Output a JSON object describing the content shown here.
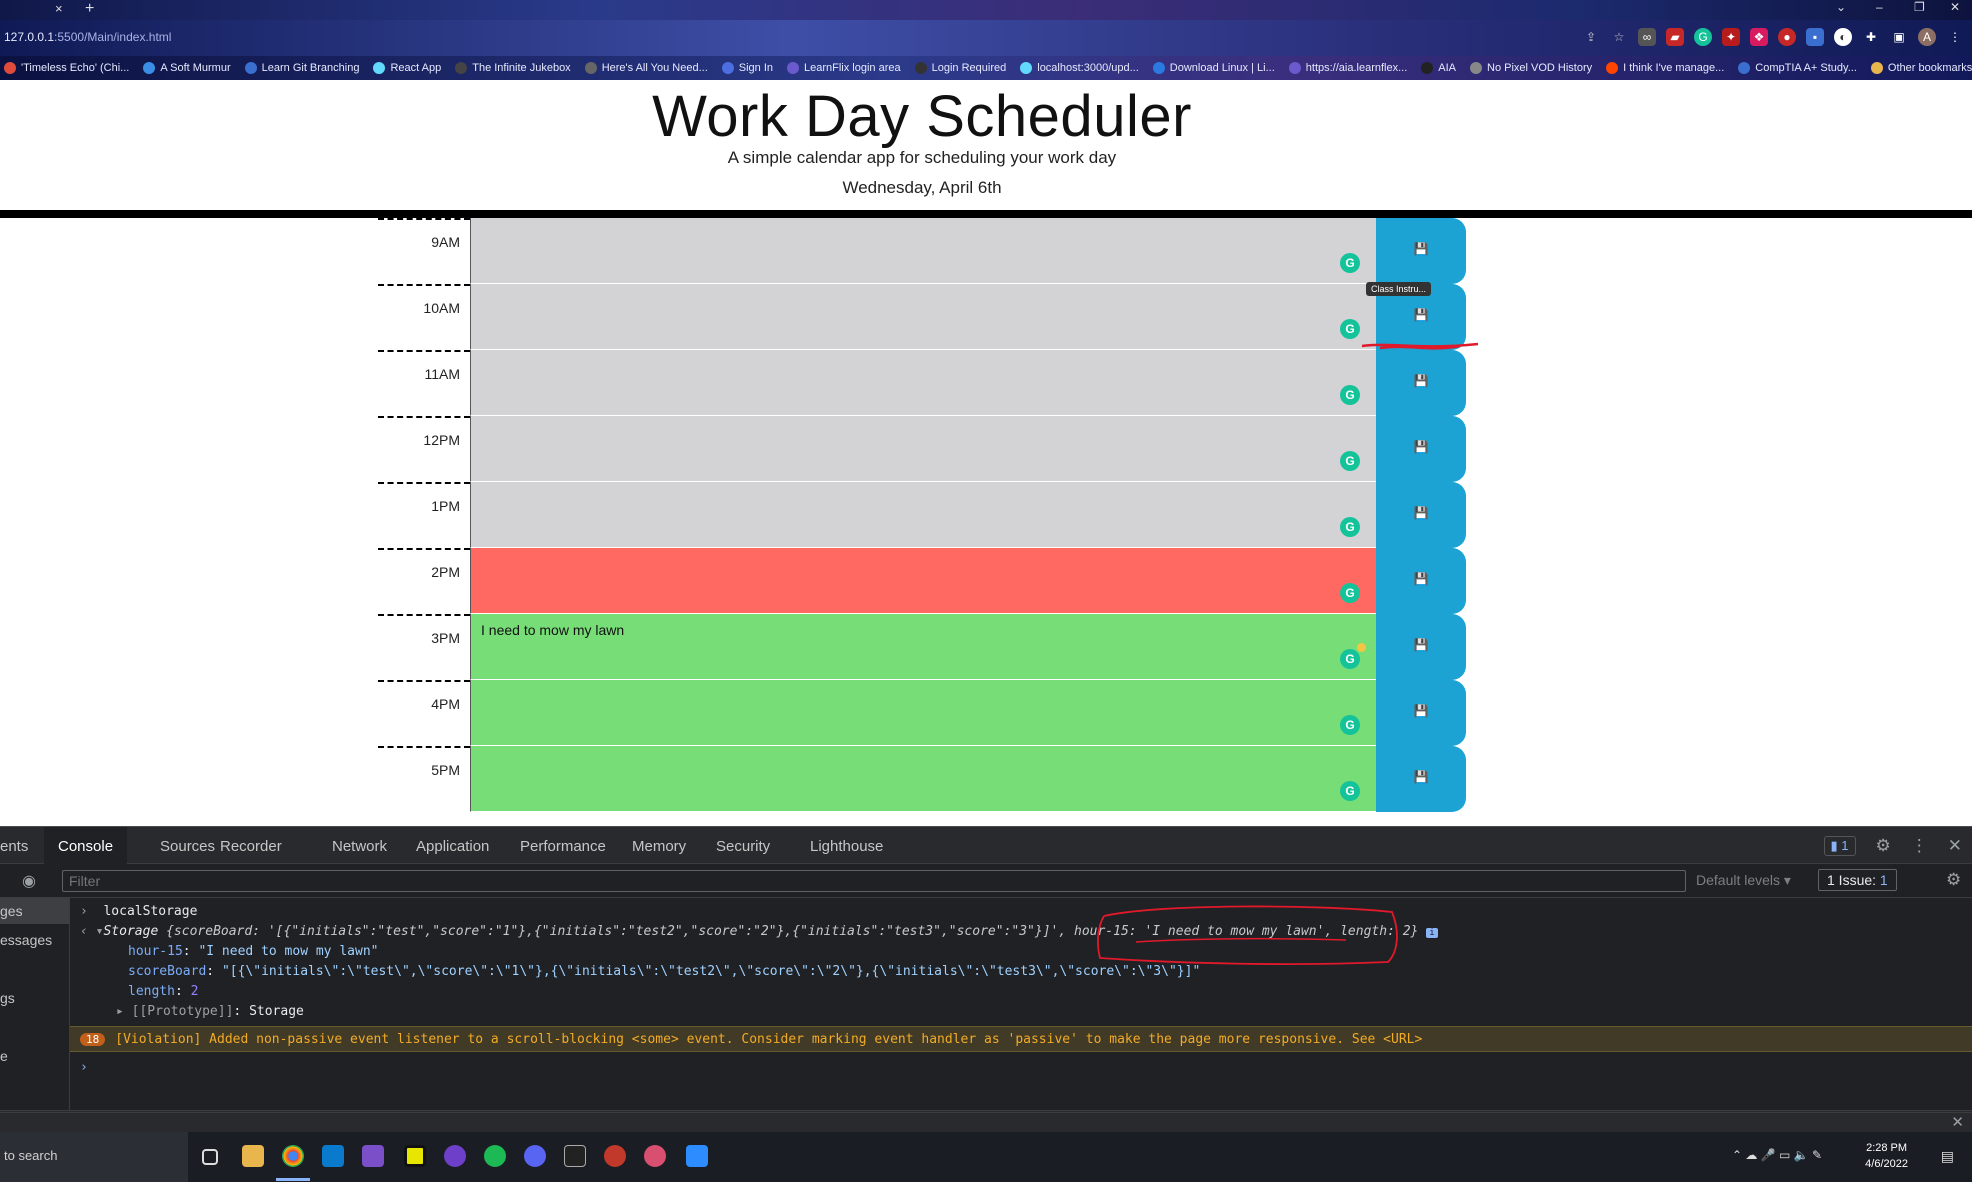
{
  "browser": {
    "close_tab": "×",
    "new_tab": "+",
    "window_controls": [
      "⌄",
      "–",
      "❐",
      "✕"
    ],
    "url_host": "127.0.0.1",
    "url_path": ":5500/Main/index.html",
    "bookmarks": [
      {
        "label": "'Timeless Echo' (Chi...",
        "color": "#e04b3c"
      },
      {
        "label": "A Soft Murmur",
        "color": "#3a8ee6"
      },
      {
        "label": "Learn Git Branching",
        "color": "#3a6fd0"
      },
      {
        "label": "React App",
        "color": "#61dafb"
      },
      {
        "label": "The Infinite Jukebox",
        "color": "#444"
      },
      {
        "label": "Here's All You Need...",
        "color": "#666"
      },
      {
        "label": "Sign In",
        "color": "#4b6fe0"
      },
      {
        "label": "LearnFlix login area",
        "color": "#6a5acd"
      },
      {
        "label": "Login Required",
        "color": "#333"
      },
      {
        "label": "localhost:3000/upd...",
        "color": "#61dafb"
      },
      {
        "label": "Download Linux | Li...",
        "color": "#2a7ae2"
      },
      {
        "label": "https://aia.learnflex...",
        "color": "#6a5acd"
      },
      {
        "label": "AIA",
        "color": "#222"
      },
      {
        "label": "No Pixel VOD History",
        "color": "#888"
      },
      {
        "label": "I think I've manage...",
        "color": "#ff4500"
      },
      {
        "label": "CompTIA A+ Study...",
        "color": "#3a6fd0"
      },
      {
        "label": "Other bookmarks",
        "color": "#e8b64c"
      }
    ]
  },
  "page": {
    "title": "Work Day Scheduler",
    "subtitle": "A simple calendar app for scheduling your work day",
    "date": "Wednesday, April 6th",
    "save_icon": "💾",
    "grammarly_glyph": "G",
    "tooltip": "Class Instru...",
    "rows": [
      {
        "hour": "9AM",
        "text": "",
        "state": "past"
      },
      {
        "hour": "10AM",
        "text": "",
        "state": "past"
      },
      {
        "hour": "11AM",
        "text": "",
        "state": "past"
      },
      {
        "hour": "12PM",
        "text": "",
        "state": "past"
      },
      {
        "hour": "1PM",
        "text": "",
        "state": "past"
      },
      {
        "hour": "2PM",
        "text": "",
        "state": "present"
      },
      {
        "hour": "3PM",
        "text": "I need to mow my lawn",
        "state": "future"
      },
      {
        "hour": "4PM",
        "text": "",
        "state": "future"
      },
      {
        "hour": "5PM",
        "text": "",
        "state": "future"
      }
    ]
  },
  "devtools": {
    "tabs": [
      "ents",
      "Console",
      "Sources",
      "Recorder",
      "Network",
      "Application",
      "Performance",
      "Memory",
      "Security",
      "Lighthouse"
    ],
    "issues_badge": "1",
    "filter_placeholder": "Filter",
    "default_levels": "Default levels ▾",
    "issues_count": "1 Issue:",
    "issues_count_num": "1",
    "sidebar": [
      "ges",
      "essages",
      "gs",
      "e"
    ],
    "console": {
      "command": "localStorage",
      "storage_label": "Storage",
      "storage_summary": "{scoreBoard: '[{\"initials\":\"test\",\"score\":\"1\"},{\"initials\":\"test2\",\"score\":\"2\"},{\"initials\":\"test3\",\"score\":\"3\"}]', hour-15: 'I need to mow my lawn', length: 2}",
      "hour_key": "hour-15",
      "hour_value": "\"I need to mow my lawn\"",
      "score_key": "scoreBoard",
      "score_value": "\"[{\\\"initials\\\":\\\"test\\\",\\\"score\\\":\\\"1\\\"},{\\\"initials\\\":\\\"test2\\\",\\\"score\\\":\\\"2\\\"},{\\\"initials\\\":\\\"test3\\\",\\\"score\\\":\\\"3\\\"}]\"",
      "length_key": "length",
      "length_value": "2",
      "proto_key": "[[Prototype]]",
      "proto_value": "Storage",
      "warning_count": "18",
      "warning_text": "[Violation] Added non-passive event listener to a scroll-blocking <some> event. Consider marking event handler as 'passive' to make the page more responsive. See <URL>"
    }
  },
  "taskbar": {
    "search_text": "to search",
    "time": "2:28 PM",
    "date": "4/6/2022"
  }
}
